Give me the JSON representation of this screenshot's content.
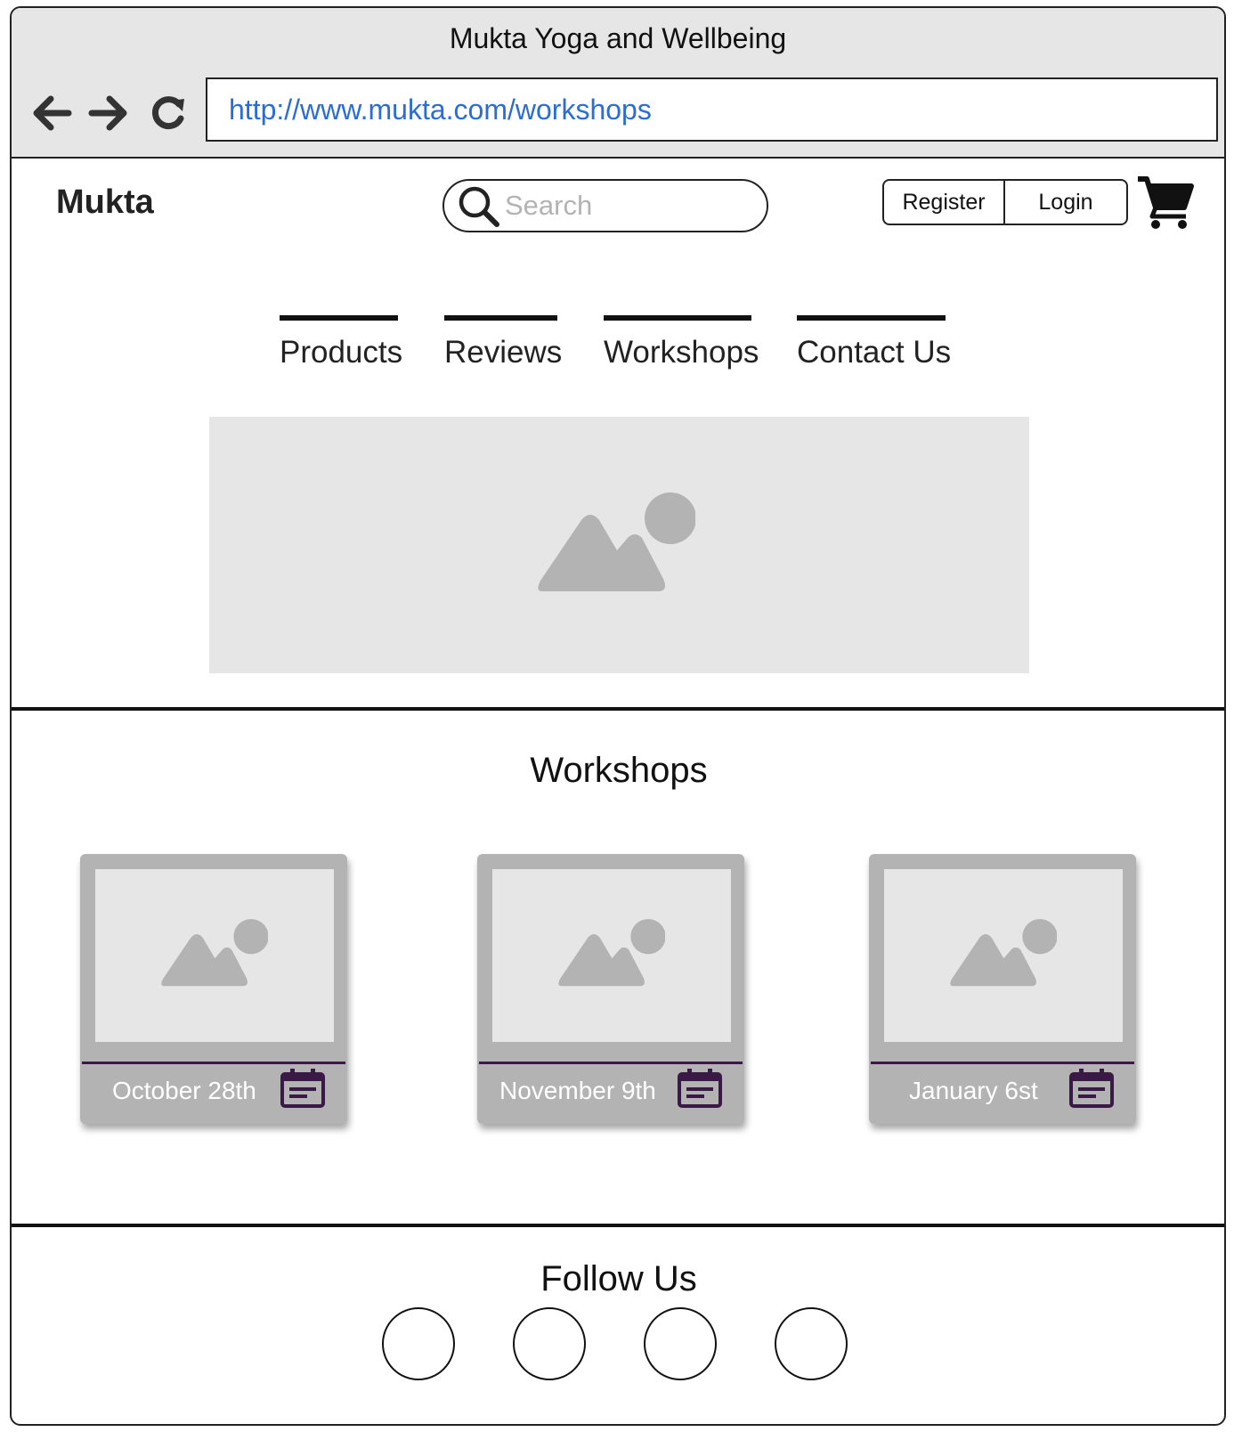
{
  "window": {
    "title": "Mukta Yoga and Wellbeing"
  },
  "address_bar": {
    "url": "http://www.mukta.com/workshops"
  },
  "icons": {
    "back": "arrow-left-icon",
    "forward": "arrow-right-icon",
    "reload": "reload-icon",
    "search": "search-icon",
    "cart": "shopping-cart-icon",
    "calendar": "calendar-icon",
    "image_placeholder": "image-placeholder-icon"
  },
  "header": {
    "brand": "Mukta",
    "search_placeholder": "Search",
    "register_label": "Register",
    "login_label": "Login"
  },
  "nav": {
    "tabs": [
      {
        "label": "Products"
      },
      {
        "label": "Reviews"
      },
      {
        "label": "Workshops"
      },
      {
        "label": "Contact Us"
      }
    ]
  },
  "workshops": {
    "title": "Workshops",
    "cards": [
      {
        "date": "October 28th"
      },
      {
        "date": "November 9th"
      },
      {
        "date": "January 6st"
      }
    ]
  },
  "footer": {
    "title": "Follow Us",
    "social_count": 4
  },
  "colors": {
    "link": "#2a6dd6",
    "placeholder_bg": "#e6e6e6",
    "placeholder_shape": "#b3b3b3",
    "accent": "#3a1947"
  }
}
